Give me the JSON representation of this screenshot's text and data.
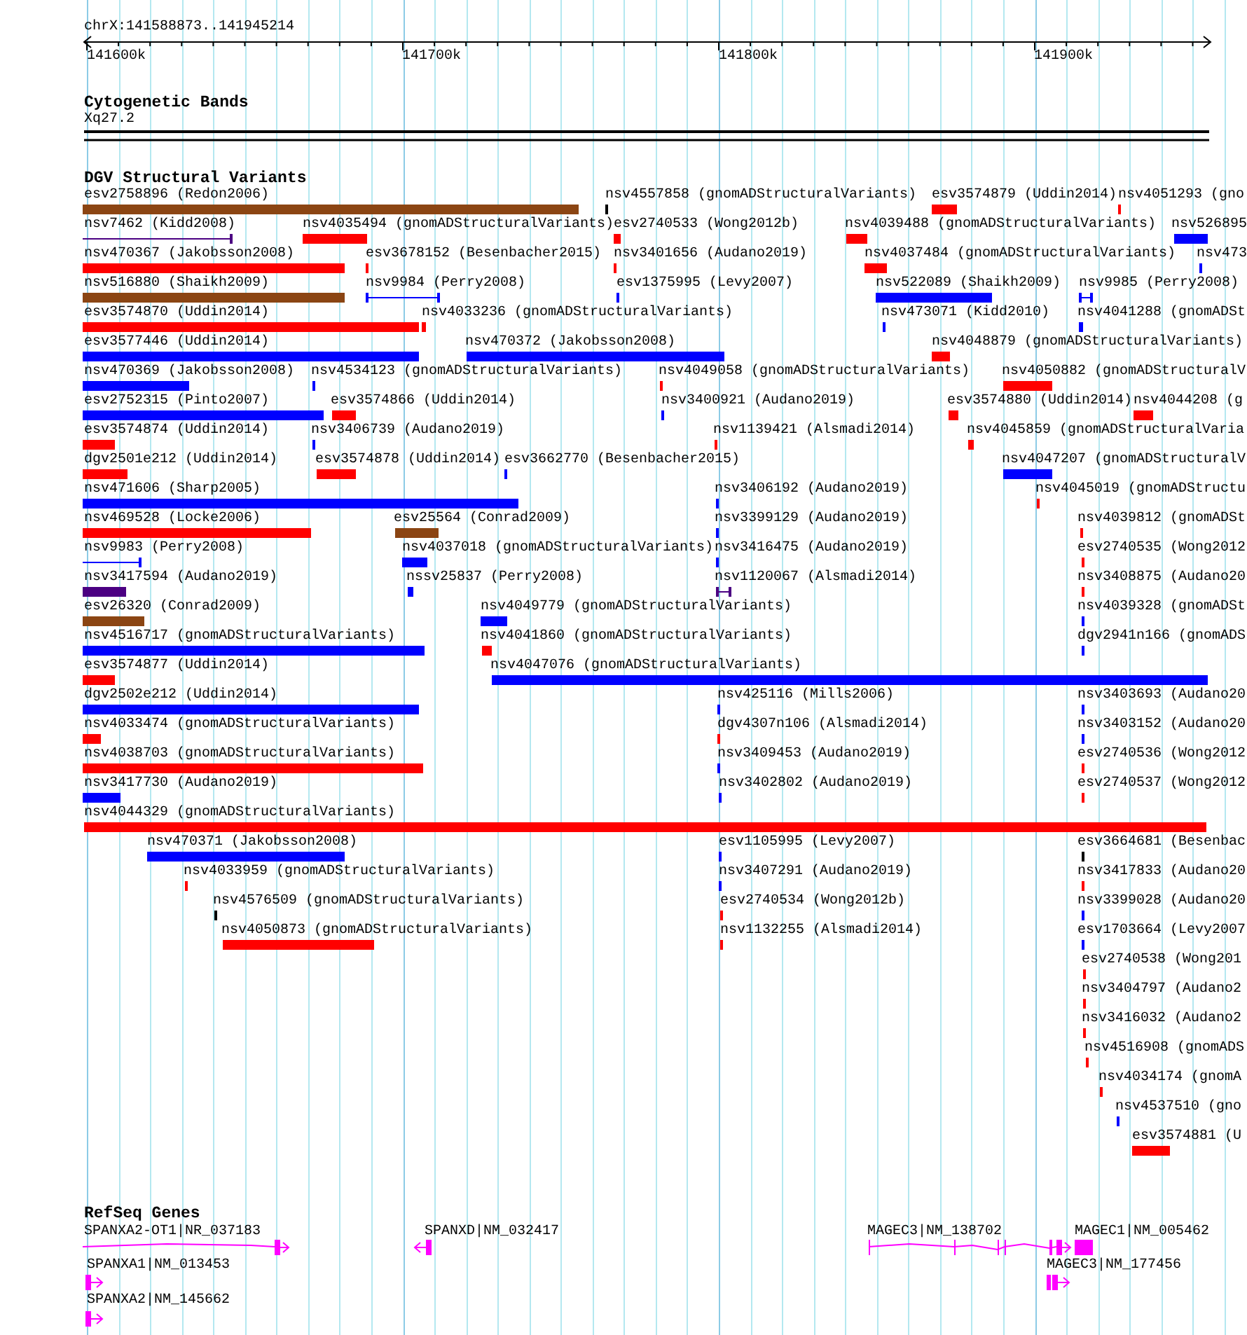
{
  "ruler": {
    "location": "chrX:141588873..141945214",
    "ticks": [
      "141600k",
      "141700k",
      "141800k",
      "141900k"
    ]
  },
  "cytogenetic_bands": {
    "title": "Cytogenetic Bands",
    "band": "Xq27.2"
  },
  "dgv": {
    "title": "DGV Structural Variants",
    "rows": [
      [
        {
          "label": "esv2758896 (Redon2006)",
          "color": "#8b4513",
          "kind": "bar"
        },
        {
          "label": "nsv4557858 (gnomADStructuralVariants)",
          "color": "#000000",
          "kind": "bar"
        },
        {
          "label": "esv3574879 (Uddin2014)",
          "color": "#ff0000",
          "kind": "bar"
        },
        {
          "label": "nsv4051293 (gno",
          "color": "#ff0000",
          "kind": "bar"
        }
      ],
      [
        {
          "label": "nsv7462 (Kidd2008)",
          "color": "#4b0082",
          "kind": "span"
        },
        {
          "label": "nsv4035494 (gnomADStructuralVariants)",
          "color": "#ff0000",
          "kind": "bar"
        },
        {
          "label": "esv2740533 (Wong2012b)",
          "color": "#ff0000",
          "kind": "bar"
        },
        {
          "label": "nsv4039488 (gnomADStructuralVariants)",
          "color": "#ff0000",
          "kind": "bar"
        },
        {
          "label": "nsv526895",
          "color": "#0000ff",
          "kind": "bar"
        }
      ],
      [
        {
          "label": "nsv470367 (Jakobsson2008)",
          "color": "#ff0000",
          "kind": "bar"
        },
        {
          "label": "esv3678152 (Besenbacher2015)",
          "color": "#ff0000",
          "kind": "bar"
        },
        {
          "label": "nsv3401656 (Audano2019)",
          "color": "#ff0000",
          "kind": "bar"
        },
        {
          "label": "nsv4037484 (gnomADStructuralVariants)",
          "color": "#ff0000",
          "kind": "bar"
        },
        {
          "label": "nsv473",
          "color": "#0000ff",
          "kind": "bar"
        }
      ],
      [
        {
          "label": "nsv516880 (Shaikh2009)",
          "color": "#8b4513",
          "kind": "bar"
        },
        {
          "label": "nsv9984 (Perry2008)",
          "color": "#0000ff",
          "kind": "span"
        },
        {
          "label": "esv1375995 (Levy2007)",
          "color": "#0000ff",
          "kind": "bar"
        },
        {
          "label": "nsv522089 (Shaikh2009)",
          "color": "#0000ff",
          "kind": "bar"
        },
        {
          "label": "nsv9985 (Perry2008)",
          "color": "#0000ff",
          "kind": "span"
        }
      ],
      [
        {
          "label": "esv3574870 (Uddin2014)",
          "color": "#ff0000",
          "kind": "bar"
        },
        {
          "label": "nsv4033236 (gnomADStructuralVariants)",
          "color": "#ff0000",
          "kind": "bar"
        },
        {
          "label": "nsv473071 (Kidd2010)",
          "color": "#0000ff",
          "kind": "bar"
        },
        {
          "label": "nsv4041288 (gnomADSt",
          "color": "#0000ff",
          "kind": "bar"
        }
      ],
      [
        {
          "label": "esv3577446 (Uddin2014)",
          "color": "#0000ff",
          "kind": "bar"
        },
        {
          "label": "nsv470372 (Jakobsson2008)",
          "color": "#0000ff",
          "kind": "bar"
        },
        {
          "label": "nsv4048879 (gnomADStructuralVariants)",
          "color": "#ff0000",
          "kind": "bar"
        }
      ],
      [
        {
          "label": "nsv470369 (Jakobsson2008)",
          "color": "#0000ff",
          "kind": "bar"
        },
        {
          "label": "nsv4534123 (gnomADStructuralVariants)",
          "color": "#0000ff",
          "kind": "bar"
        },
        {
          "label": "nsv4049058 (gnomADStructuralVariants)",
          "color": "#ff0000",
          "kind": "bar"
        },
        {
          "label": "nsv4050882 (gnomADStructuralV",
          "color": "#ff0000",
          "kind": "bar"
        }
      ],
      [
        {
          "label": "esv2752315 (Pinto2007)",
          "color": "#0000ff",
          "kind": "bar"
        },
        {
          "label": "esv3574866 (Uddin2014)",
          "color": "#ff0000",
          "kind": "bar"
        },
        {
          "label": "nsv3400921 (Audano2019)",
          "color": "#0000ff",
          "kind": "bar"
        },
        {
          "label": "esv3574880 (Uddin2014)",
          "color": "#ff0000",
          "kind": "bar"
        },
        {
          "label": "nsv4044208 (g",
          "color": "#ff0000",
          "kind": "bar"
        }
      ],
      [
        {
          "label": "esv3574874 (Uddin2014)",
          "color": "#ff0000",
          "kind": "bar"
        },
        {
          "label": "nsv3406739 (Audano2019)",
          "color": "#0000ff",
          "kind": "bar"
        },
        {
          "label": "nsv1139421 (Alsmadi2014)",
          "color": "#ff0000",
          "kind": "bar"
        },
        {
          "label": "nsv4045859 (gnomADStructuralVaria",
          "color": "#ff0000",
          "kind": "bar"
        }
      ],
      [
        {
          "label": "dgv2501e212 (Uddin2014)",
          "color": "#ff0000",
          "kind": "bar"
        },
        {
          "label": "esv3574878 (Uddin2014)",
          "color": "#ff0000",
          "kind": "bar"
        },
        {
          "label": "esv3662770 (Besenbacher2015)",
          "color": "#0000ff",
          "kind": "bar"
        },
        {
          "label": "nsv4047207 (gnomADStructuralV",
          "color": "#0000ff",
          "kind": "bar"
        }
      ],
      [
        {
          "label": "nsv471606 (Sharp2005)",
          "color": "#0000ff",
          "kind": "bar"
        },
        {
          "label": "nsv3406192 (Audano2019)",
          "color": "#0000ff",
          "kind": "bar"
        },
        {
          "label": "nsv4045019 (gnomADStructu",
          "color": "#ff0000",
          "kind": "bar"
        }
      ],
      [
        {
          "label": "nsv469528 (Locke2006)",
          "color": "#ff0000",
          "kind": "bar"
        },
        {
          "label": "esv25564 (Conrad2009)",
          "color": "#8b4513",
          "kind": "bar"
        },
        {
          "label": "nsv3399129 (Audano2019)",
          "color": "#0000ff",
          "kind": "bar"
        },
        {
          "label": "nsv4039812 (gnomADSt",
          "color": "#ff0000",
          "kind": "bar"
        }
      ],
      [
        {
          "label": "nsv9983 (Perry2008)",
          "color": "#0000ff",
          "kind": "span"
        },
        {
          "label": "nsv4037018 (gnomADStructuralVariants)",
          "color": "#0000ff",
          "kind": "bar"
        },
        {
          "label": "nsv3416475 (Audano2019)",
          "color": "#0000ff",
          "kind": "bar"
        },
        {
          "label": "esv2740535 (Wong2012",
          "color": "#ff0000",
          "kind": "bar"
        }
      ],
      [
        {
          "label": "nsv3417594 (Audano2019)",
          "color": "#4b0082",
          "kind": "bar"
        },
        {
          "label": "nssv25837 (Perry2008)",
          "color": "#0000ff",
          "kind": "bar"
        },
        {
          "label": "nsv1120067 (Alsmadi2014)",
          "color": "#4b0082",
          "kind": "span"
        },
        {
          "label": "nsv3408875 (Audano20",
          "color": "#ff0000",
          "kind": "bar"
        }
      ],
      [
        {
          "label": "esv26320 (Conrad2009)",
          "color": "#8b4513",
          "kind": "bar"
        },
        {
          "label": "nsv4049779 (gnomADStructuralVariants)",
          "color": "#0000ff",
          "kind": "bar"
        },
        {
          "label": "nsv4039328 (gnomADSt",
          "color": "#0000ff",
          "kind": "bar"
        }
      ],
      [
        {
          "label": "nsv4516717 (gnomADStructuralVariants)",
          "color": "#0000ff",
          "kind": "bar"
        },
        {
          "label": "nsv4041860 (gnomADStructuralVariants)",
          "color": "#ff0000",
          "kind": "bar"
        },
        {
          "label": "dgv2941n166 (gnomADS",
          "color": "#0000ff",
          "kind": "bar"
        }
      ],
      [
        {
          "label": "esv3574877 (Uddin2014)",
          "color": "#ff0000",
          "kind": "bar"
        },
        {
          "label": "nsv4047076 (gnomADStructuralVariants)",
          "color": "#0000ff",
          "kind": "bar"
        }
      ],
      [
        {
          "label": "dgv2502e212 (Uddin2014)",
          "color": "#0000ff",
          "kind": "bar"
        },
        {
          "label": "nsv425116 (Mills2006)",
          "color": "#0000ff",
          "kind": "bar"
        },
        {
          "label": "nsv3403693 (Audano20",
          "color": "#0000ff",
          "kind": "bar"
        }
      ],
      [
        {
          "label": "nsv4033474 (gnomADStructuralVariants)",
          "color": "#ff0000",
          "kind": "bar"
        },
        {
          "label": "dgv4307n106 (Alsmadi2014)",
          "color": "#ff0000",
          "kind": "bar"
        },
        {
          "label": "nsv3403152 (Audano20",
          "color": "#0000ff",
          "kind": "bar"
        }
      ],
      [
        {
          "label": "nsv4038703 (gnomADStructuralVariants)",
          "color": "#ff0000",
          "kind": "bar"
        },
        {
          "label": "nsv3409453 (Audano2019)",
          "color": "#0000ff",
          "kind": "bar"
        },
        {
          "label": "esv2740536 (Wong2012",
          "color": "#ff0000",
          "kind": "bar"
        }
      ],
      [
        {
          "label": "nsv3417730 (Audano2019)",
          "color": "#0000ff",
          "kind": "bar"
        },
        {
          "label": "nsv3402802 (Audano2019)",
          "color": "#0000ff",
          "kind": "bar"
        },
        {
          "label": "esv2740537 (Wong2012",
          "color": "#ff0000",
          "kind": "bar"
        }
      ],
      [
        {
          "label": "nsv4044329 (gnomADStructuralVariants)",
          "color": "#ff0000",
          "kind": "bar"
        }
      ],
      [
        {
          "label": "nsv470371 (Jakobsson2008)",
          "color": "#0000ff",
          "kind": "bar"
        },
        {
          "label": "esv1105995 (Levy2007)",
          "color": "#0000ff",
          "kind": "bar"
        },
        {
          "label": "esv3664681 (Besenbac",
          "color": "#000000",
          "kind": "bar"
        }
      ],
      [
        {
          "label": "nsv4033959 (gnomADStructuralVariants)",
          "color": "#ff0000",
          "kind": "bar"
        },
        {
          "label": "nsv3407291 (Audano2019)",
          "color": "#0000ff",
          "kind": "bar"
        },
        {
          "label": "nsv3417833 (Audano20",
          "color": "#ff0000",
          "kind": "bar"
        }
      ],
      [
        {
          "label": "nsv4576509 (gnomADStructuralVariants)",
          "color": "#000000",
          "kind": "bar"
        },
        {
          "label": "esv2740534 (Wong2012b)",
          "color": "#ff0000",
          "kind": "bar"
        },
        {
          "label": "nsv3399028 (Audano20",
          "color": "#0000ff",
          "kind": "bar"
        }
      ],
      [
        {
          "label": "nsv4050873 (gnomADStructuralVariants)",
          "color": "#ff0000",
          "kind": "bar"
        },
        {
          "label": "nsv1132255 (Alsmadi2014)",
          "color": "#ff0000",
          "kind": "bar"
        },
        {
          "label": "esv1703664 (Levy2007",
          "color": "#0000ff",
          "kind": "bar"
        }
      ],
      [
        {
          "label": "esv2740538 (Wong201",
          "color": "#ff0000",
          "kind": "bar"
        }
      ],
      [
        {
          "label": "nsv3404797 (Audano2",
          "color": "#ff0000",
          "kind": "bar"
        }
      ],
      [
        {
          "label": "nsv3416032 (Audano2",
          "color": "#ff0000",
          "kind": "bar"
        }
      ],
      [
        {
          "label": "nsv4516908 (gnomADS",
          "color": "#ff0000",
          "kind": "bar"
        }
      ],
      [
        {
          "label": "nsv4034174 (gnomA",
          "color": "#ff0000",
          "kind": "bar"
        }
      ],
      [
        {
          "label": "nsv4537510 (gno",
          "color": "#0000ff",
          "kind": "bar"
        }
      ],
      [
        {
          "label": "esv3574881 (U",
          "color": "#ff0000",
          "kind": "bar"
        }
      ]
    ]
  },
  "refseq": {
    "title": "RefSeq Genes",
    "genes": [
      {
        "label": "SPANXA2-OT1|NR_037183",
        "kind": "forward"
      },
      {
        "label": "SPANXD|NM_032417",
        "kind": "reverse"
      },
      {
        "label": "MAGEC3|NM_138702",
        "kind": "forward"
      },
      {
        "label": "MAGEC1|NM_005462",
        "kind": "block"
      },
      {
        "label": "SPANXA1|NM_013453",
        "kind": "forward"
      },
      {
        "label": "MAGEC3|NM_177456",
        "kind": "forward"
      },
      {
        "label": "SPANXA2|NM_145662",
        "kind": "forward"
      }
    ]
  }
}
